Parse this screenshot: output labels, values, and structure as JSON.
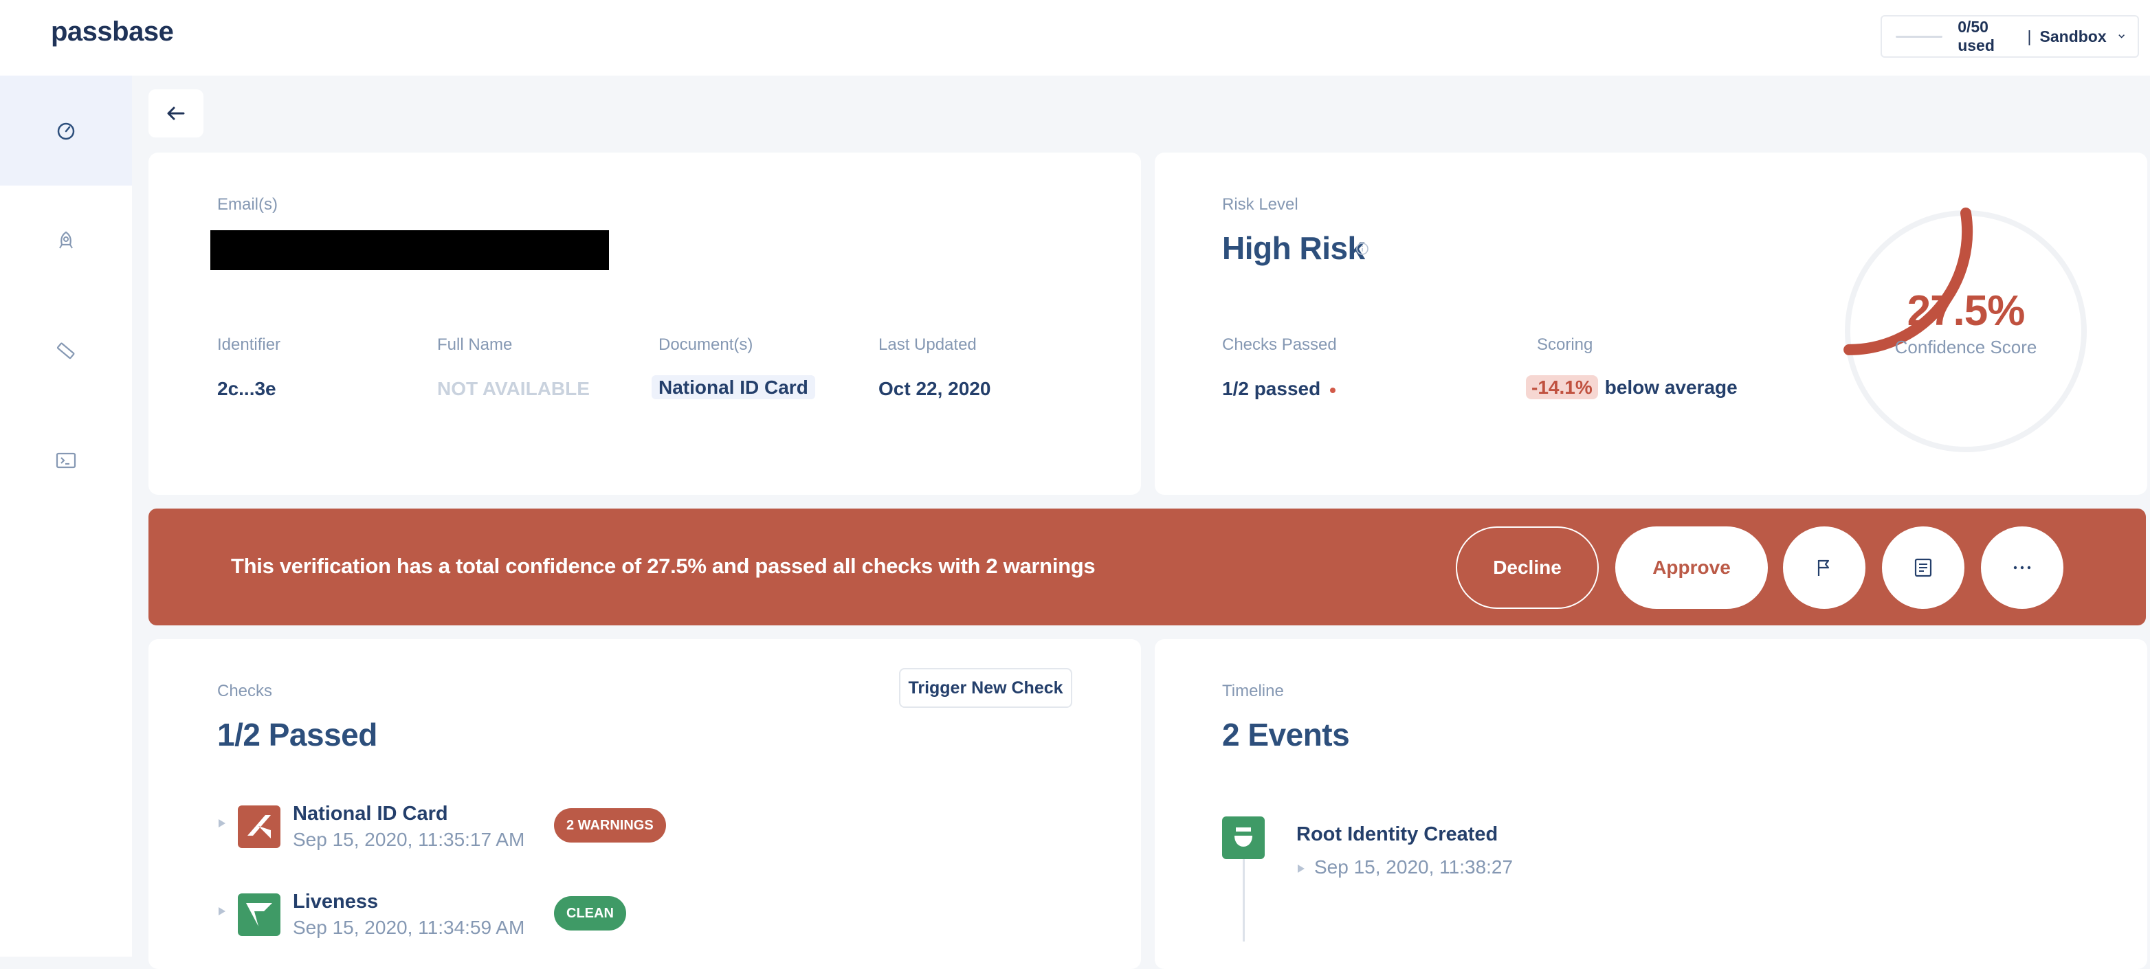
{
  "app": {
    "logo": "passbase"
  },
  "environment": {
    "usage": "0/50 used",
    "separator": "|",
    "mode": "Sandbox"
  },
  "sidebar": {
    "items": [
      {
        "icon": "speedometer-icon",
        "active": true
      },
      {
        "icon": "rocket-icon",
        "active": false
      },
      {
        "icon": "ruler-icon",
        "active": false
      },
      {
        "icon": "terminal-icon",
        "active": false
      }
    ]
  },
  "identity": {
    "email_label": "Email(s)",
    "identifier_label": "Identifier",
    "identifier_value": "2c...3e",
    "fullname_label": "Full Name",
    "fullname_value": "NOT AVAILABLE",
    "documents_label": "Document(s)",
    "documents_value": "National ID Card",
    "updated_label": "Last Updated",
    "updated_value": "Oct 22, 2020"
  },
  "risk": {
    "label": "Risk Level",
    "level": "High Risk",
    "checks_label": "Checks Passed",
    "checks_value": "1/2 passed",
    "scoring_label": "Scoring",
    "scoring_delta": "-14.1%",
    "scoring_text": "below average",
    "confidence_value": "27.5%",
    "confidence_label": "Confidence Score",
    "confidence_fraction": 0.275,
    "accent": "#c0513f"
  },
  "banner": {
    "message": "This verification has a total confidence of 27.5% and passed all checks with 2 warnings",
    "decline_label": "Decline",
    "approve_label": "Approve",
    "color": "#bb5a47"
  },
  "checks": {
    "label": "Checks",
    "summary": "1/2 Passed",
    "trigger_label": "Trigger New Check",
    "items": [
      {
        "name": "National ID Card",
        "date": "Sep 15, 2020, 11:35:17 AM",
        "badge": "2 WARNINGS",
        "badge_color": "#bb5a47"
      },
      {
        "name": "Liveness",
        "date": "Sep 15, 2020, 11:34:59 AM",
        "badge": "CLEAN",
        "badge_color": "#3f9a66"
      }
    ]
  },
  "timeline": {
    "label": "Timeline",
    "summary": "2 Events",
    "events": [
      {
        "name": "Root Identity Created",
        "date": "Sep 15, 2020, 11:38:27"
      }
    ]
  }
}
